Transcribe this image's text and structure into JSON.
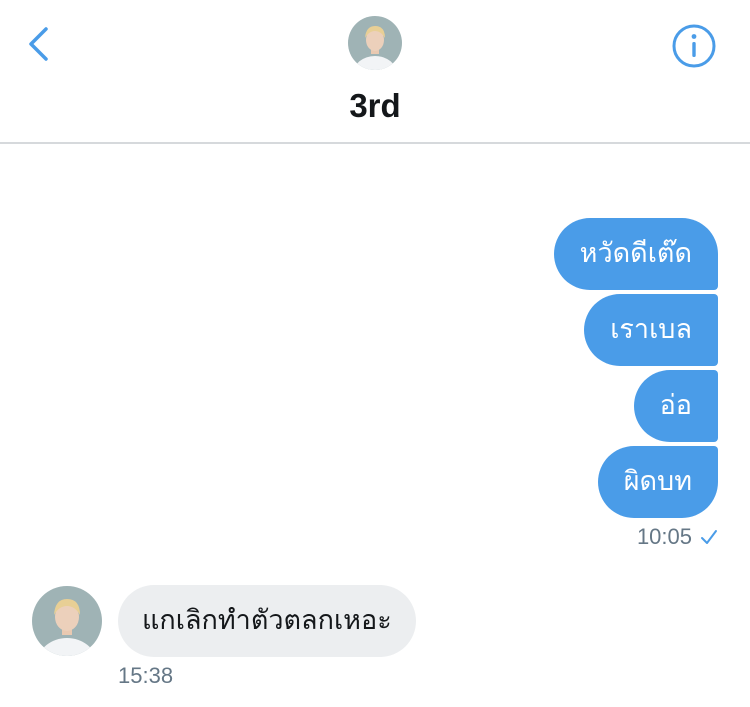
{
  "header": {
    "title": "3rd",
    "back_icon": "chevron-left-icon",
    "info_icon": "info-icon"
  },
  "messages": [
    {
      "direction": "out",
      "text": "หวัดดีเต๊ด"
    },
    {
      "direction": "out",
      "text": "เราเบล"
    },
    {
      "direction": "out",
      "text": "อ่อ"
    },
    {
      "direction": "out",
      "text": "ผิดบท"
    },
    {
      "direction": "in",
      "text": "แกเลิกทำตัวตลกเหอะ"
    }
  ],
  "outgoing_timestamp": "10:05",
  "incoming_timestamp": "15:38",
  "colors": {
    "accent": "#4a9ce8",
    "incoming_bubble": "#eceef0",
    "timestamp": "#657786",
    "title": "#14171a"
  }
}
